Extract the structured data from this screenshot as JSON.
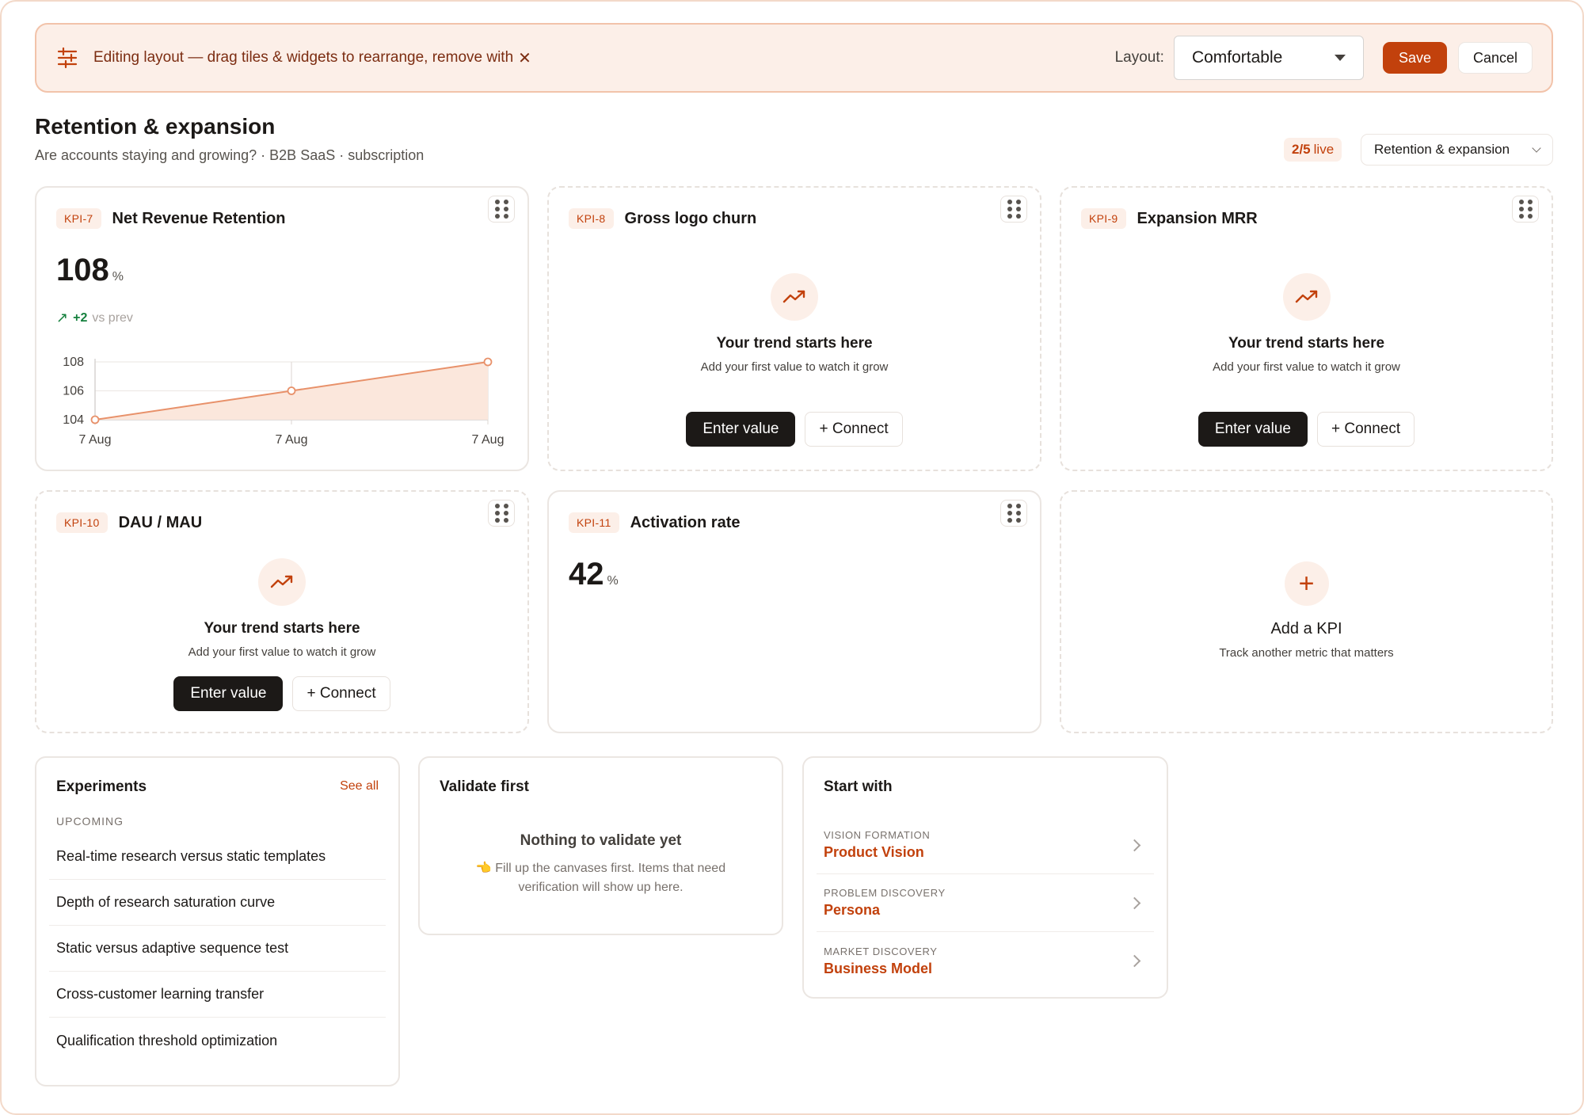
{
  "banner": {
    "text": "Editing layout — drag tiles & widgets to rearrange, remove with",
    "remove_glyph": "✕",
    "icon": "sliders-icon",
    "layout_label": "Layout:",
    "layout_value": "Comfortable",
    "save_label": "Save",
    "cancel_label": "Cancel"
  },
  "header": {
    "title": "Retention & expansion",
    "subtitle": "Are accounts staying and growing? · B2B SaaS · subscription",
    "live_count": "2/5",
    "live_label": "live",
    "view_select": "Retention & expansion"
  },
  "kpis": [
    {
      "tag": "KPI-7",
      "title": "Net Revenue Retention",
      "value": "108",
      "unit": "%",
      "delta": "+2",
      "delta_label": "vs prev",
      "chart_data": {
        "type": "area",
        "x": [
          "7 Aug",
          "7 Aug",
          "7 Aug"
        ],
        "values": [
          104,
          106,
          108
        ],
        "ylim": [
          104,
          108
        ],
        "y_ticks": [
          "108",
          "106",
          "104"
        ],
        "grid": true,
        "color": "#e8916a"
      }
    },
    {
      "tag": "KPI-8",
      "title": "Gross logo churn",
      "empty_title": "Your trend starts here",
      "empty_sub": "Add your first value to watch it grow",
      "enter_label": "Enter value",
      "connect_label": "+ Connect"
    },
    {
      "tag": "KPI-9",
      "title": "Expansion MRR",
      "empty_title": "Your trend starts here",
      "empty_sub": "Add your first value to watch it grow",
      "enter_label": "Enter value",
      "connect_label": "+ Connect"
    },
    {
      "tag": "KPI-10",
      "title": "DAU / MAU",
      "empty_title": "Your trend starts here",
      "empty_sub": "Add your first value to watch it grow",
      "enter_label": "Enter value",
      "connect_label": "+ Connect"
    },
    {
      "tag": "KPI-11",
      "title": "Activation rate",
      "value": "42",
      "unit": "%"
    }
  ],
  "add_kpi": {
    "plus": "+",
    "title": "Add a KPI",
    "sub": "Track another metric that matters"
  },
  "experiments": {
    "title": "Experiments",
    "see_all": "See all",
    "section": "UPCOMING",
    "items": [
      "Real-time research versus static templates",
      "Depth of research saturation curve",
      "Static versus adaptive sequence test",
      "Cross-customer learning transfer",
      "Qualification threshold optimization"
    ]
  },
  "validate": {
    "title": "Validate first",
    "empty_title": "Nothing to validate yet",
    "empty_emoji": "👈",
    "empty_line1": "Fill up the canvases first. Items that need",
    "empty_line2": "verification will show up here."
  },
  "start_with": {
    "title": "Start with",
    "items": [
      {
        "category": "VISION FORMATION",
        "name": "Product Vision"
      },
      {
        "category": "PROBLEM DISCOVERY",
        "name": "Persona"
      },
      {
        "category": "MARKET DISCOVERY",
        "name": "Business Model"
      }
    ]
  },
  "colors": {
    "accent": "#c2410c",
    "accent_soft": "#fcefe8",
    "positive": "#15803d",
    "dark_button": "#1c1917"
  }
}
